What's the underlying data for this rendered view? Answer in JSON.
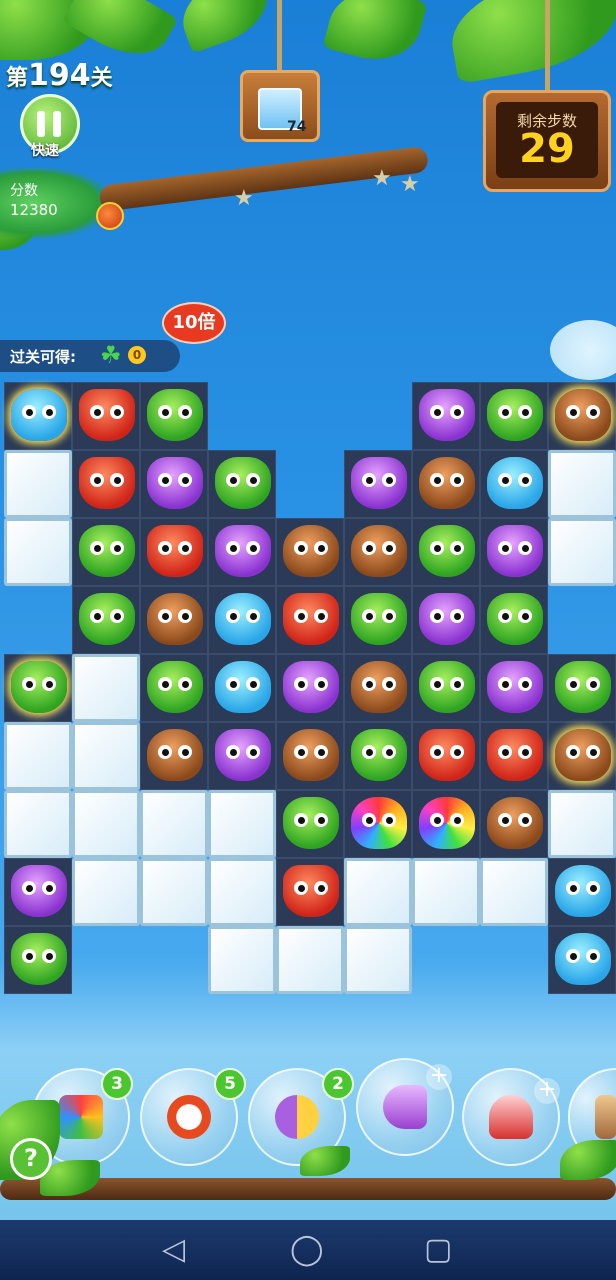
{
  "header": {
    "level_prefix": "第",
    "level_number": "194",
    "level_suffix": "关",
    "pause_label": "快速",
    "score_label": "分数",
    "score_value": "12380"
  },
  "goal": {
    "icon": "ice-block-icon",
    "count": "74"
  },
  "moves": {
    "label": "剩余步数",
    "value": "29"
  },
  "reward": {
    "label": "过关可得:",
    "clover_icon": "clover-icon",
    "amount": "0",
    "multiplier": "10倍"
  },
  "board": {
    "columns": 9,
    "rows": 9,
    "legend": {
      "x": "no cell",
      "ice": "ice block",
      "blue": "blue hippo",
      "red": "red fox",
      "green": "green frog",
      "purple": "purple owl",
      "brown": "brown bear",
      "rainbow": "rainbow owl"
    },
    "grid": [
      [
        "blue*",
        "red",
        "green",
        "x",
        "x",
        "x",
        "purple",
        "green",
        "brown*"
      ],
      [
        "ice",
        "red",
        "purple",
        "green",
        "x",
        "purple",
        "brown",
        "blue",
        "ice"
      ],
      [
        "ice",
        "green",
        "red",
        "purple",
        "brown",
        "brown",
        "green",
        "purple",
        "ice"
      ],
      [
        "x",
        "green",
        "brown",
        "blue",
        "red",
        "green",
        "purple",
        "green",
        "x"
      ],
      [
        "green*",
        "ice",
        "green",
        "blue",
        "purple",
        "brown",
        "green",
        "purple",
        "green"
      ],
      [
        "ice",
        "ice",
        "brown",
        "purple",
        "brown",
        "green",
        "red",
        "red",
        "brown*"
      ],
      [
        "ice",
        "ice",
        "ice",
        "ice",
        "green",
        "rainbow",
        "rainbow",
        "brown",
        "ice"
      ],
      [
        "purple",
        "ice",
        "ice",
        "ice",
        "red",
        "ice",
        "ice",
        "ice",
        "blue"
      ],
      [
        "green",
        "x",
        "x",
        "ice",
        "ice",
        "ice",
        "x",
        "x",
        "blue"
      ]
    ]
  },
  "boosters": [
    {
      "name": "shuffle-booster",
      "icon": "shuffle-icon",
      "count": "3"
    },
    {
      "name": "extra-moves-booster",
      "icon": "clock-icon",
      "count": "5"
    },
    {
      "name": "swap-booster",
      "icon": "swap-icon",
      "count": "2"
    },
    {
      "name": "horizontal-rocket-booster",
      "icon": "rocket-horizontal-icon",
      "count": "+"
    },
    {
      "name": "vertical-rocket-booster",
      "icon": "rocket-vertical-icon",
      "count": "+"
    },
    {
      "name": "hammer-booster",
      "icon": "hammer-icon",
      "count": ""
    }
  ],
  "help_label": "?",
  "navbar": {
    "back": "◁",
    "home": "◯",
    "recent": "▢"
  },
  "colors": {
    "sky": "#2a92e4",
    "board_dark": "#2a3a57",
    "moves_value": "#ffd21e",
    "badge_green": "#4cc630",
    "multiplier_red": "#e73a20"
  }
}
